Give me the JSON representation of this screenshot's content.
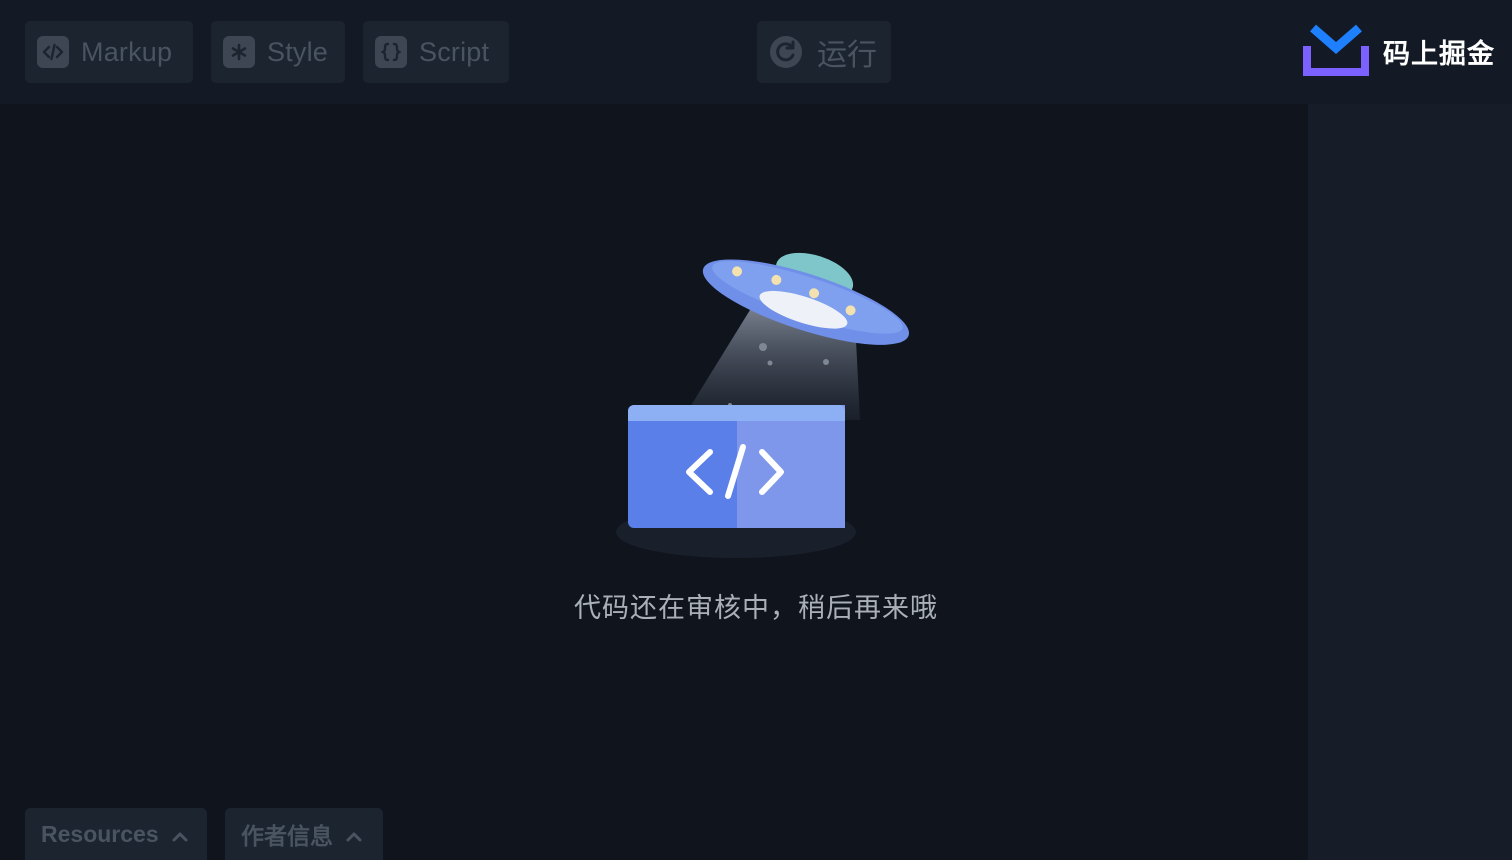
{
  "toolbar": {
    "tabs": [
      {
        "label": "Markup",
        "icon": "code-tag-icon"
      },
      {
        "label": "Style",
        "icon": "asterisk-icon"
      },
      {
        "label": "Script",
        "icon": "braces-icon"
      }
    ],
    "run_label": "运行",
    "run_icon": "refresh-icon"
  },
  "brand": {
    "name": "码上掘金",
    "logo_icon": "juejin-logo-icon",
    "logo_colors": {
      "check": "#1e80ff",
      "tray": "#7b61ff"
    }
  },
  "main": {
    "illustration_icon": "ufo-code-icon",
    "message": "代码还在审核中，稍后再来哦"
  },
  "bottom": {
    "tabs": [
      {
        "label": "Resources",
        "icon": "chevron-up-icon"
      },
      {
        "label": "作者信息",
        "icon": "chevron-up-icon"
      }
    ]
  },
  "colors": {
    "background": "#0f141d",
    "toolbar": "#141a25",
    "panel": "#1c2430",
    "muted_text": "#4a5360",
    "message_text": "#aab0b8",
    "accent_blue": "#5b7fe8"
  }
}
